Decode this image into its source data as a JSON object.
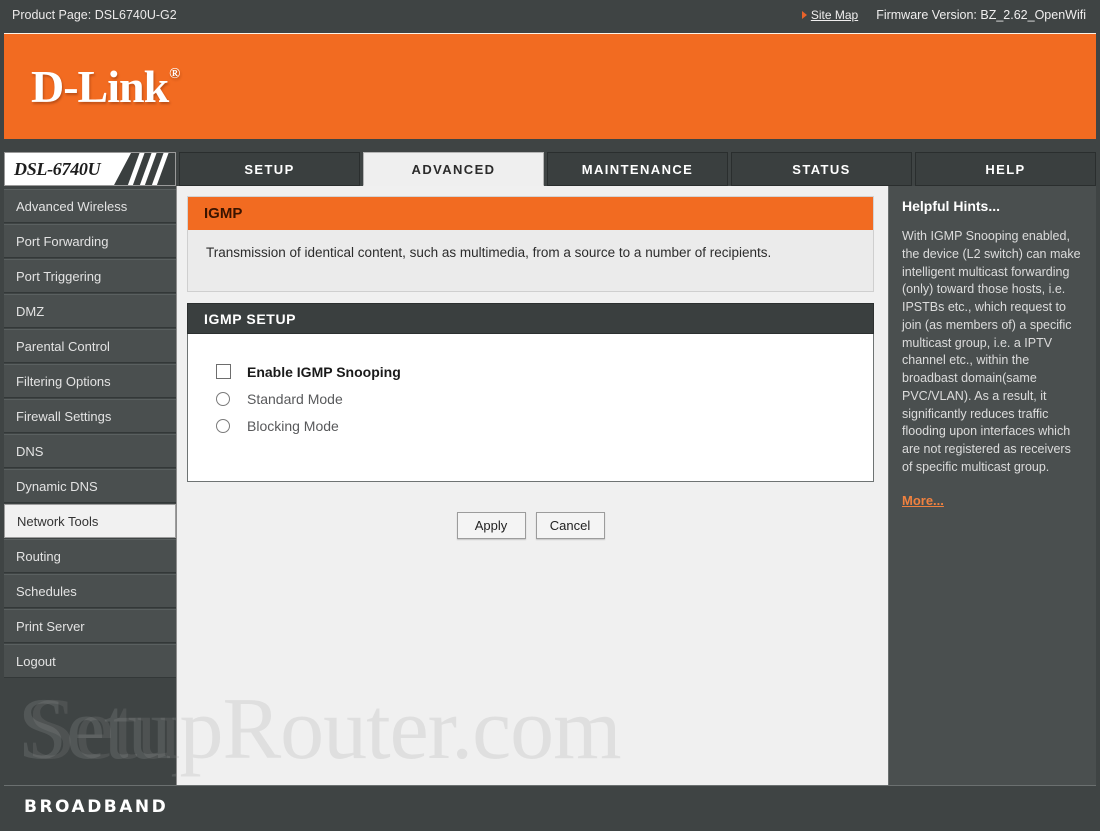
{
  "topbar": {
    "product_page": "Product Page: DSL6740U-G2",
    "site_map": "Site Map",
    "firmware": "Firmware Version: BZ_2.62_OpenWifi"
  },
  "brand": {
    "logo_text": "D-Link",
    "registered_mark": "®",
    "accent_color": "#f26b21"
  },
  "nav": {
    "model": "DSL-6740U",
    "tabs": [
      {
        "label": "SETUP",
        "active": false
      },
      {
        "label": "ADVANCED",
        "active": true
      },
      {
        "label": "MAINTENANCE",
        "active": false
      },
      {
        "label": "STATUS",
        "active": false
      },
      {
        "label": "HELP",
        "active": false
      }
    ]
  },
  "sidebar": {
    "items": [
      {
        "label": "Advanced Wireless",
        "selected": false
      },
      {
        "label": "Port Forwarding",
        "selected": false
      },
      {
        "label": "Port Triggering",
        "selected": false
      },
      {
        "label": "DMZ",
        "selected": false
      },
      {
        "label": "Parental Control",
        "selected": false
      },
      {
        "label": "Filtering Options",
        "selected": false
      },
      {
        "label": "Firewall Settings",
        "selected": false
      },
      {
        "label": "DNS",
        "selected": false
      },
      {
        "label": "Dynamic DNS",
        "selected": false
      },
      {
        "label": "Network Tools",
        "selected": true
      },
      {
        "label": "Routing",
        "selected": false
      },
      {
        "label": "Schedules",
        "selected": false
      },
      {
        "label": "Print Server",
        "selected": false
      },
      {
        "label": "Logout",
        "selected": false
      }
    ]
  },
  "main": {
    "panel_title": "IGMP",
    "panel_description": "Transmission of identical content, such as multimedia, from a source to a number of recipients.",
    "section_title": "IGMP SETUP",
    "options": [
      {
        "label": "Enable IGMP Snooping",
        "type": "checkbox",
        "checked": false
      },
      {
        "label": "Standard Mode",
        "type": "radio",
        "checked": false
      },
      {
        "label": "Blocking Mode",
        "type": "radio",
        "checked": false
      }
    ],
    "apply_label": "Apply",
    "cancel_label": "Cancel"
  },
  "hints": {
    "title": "Helpful Hints...",
    "body": "With IGMP Snooping enabled, the device (L2 switch) can make intelligent multicast forwarding (only) toward those hosts, i.e. IPSTBs etc., which request to join (as members of) a specific multicast group, i.e. a IPTV channel etc., within the broadbast domain(same PVC/VLAN). As a result, it significantly reduces traffic flooding upon interfaces which are not registered as receivers of specific multicast group.",
    "more": "More..."
  },
  "footer": {
    "label": "BROADBAND"
  },
  "watermark": {
    "text": "SetupRouter.com"
  }
}
